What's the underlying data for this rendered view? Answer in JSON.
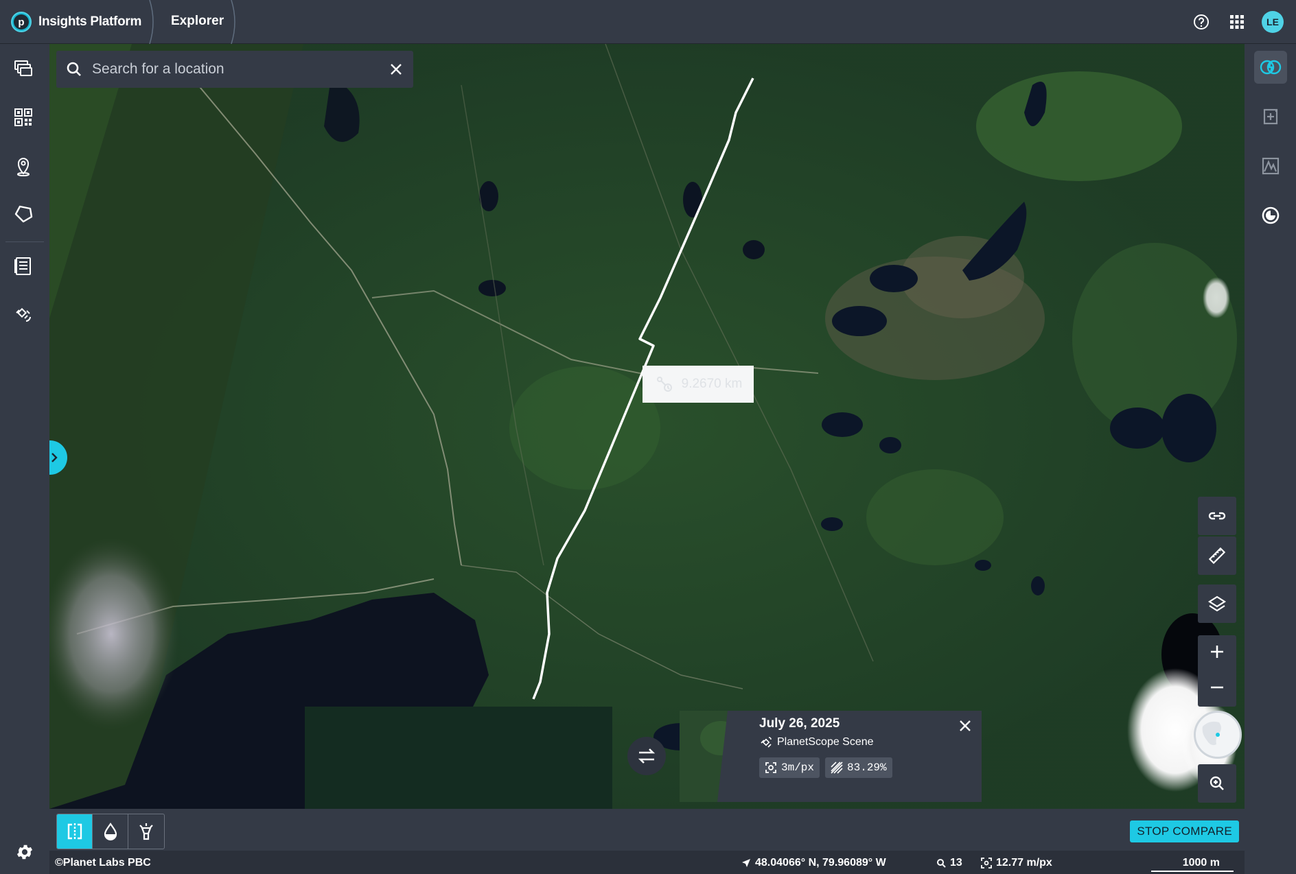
{
  "app": {
    "brand_name": "Insights Platform",
    "section": "Explorer",
    "user_initials": "LE",
    "accent_color": "#1ec9e4"
  },
  "topbar": {
    "icons": [
      "help-icon",
      "apps-grid-icon"
    ]
  },
  "left_rail": {
    "items": [
      "feeds-icon",
      "dashboard-icon",
      "places-icon",
      "areas-icon",
      "reports-icon",
      "tasking-icon"
    ],
    "settings_icon": "gear-icon"
  },
  "right_rail": {
    "items": [
      "compare-icon",
      "add-analysis-icon",
      "elevation-icon",
      "time-icon"
    ]
  },
  "search": {
    "placeholder": "Search for a location",
    "value": ""
  },
  "measurement": {
    "label": "9.2670 km"
  },
  "scene": {
    "date": "July 26, 2025",
    "type": "PlanetScope Scene",
    "resolution": "3m/px",
    "cloud_cover": "83.29%"
  },
  "map_controls": [
    "link-icon",
    "ruler-icon",
    "layers-icon",
    "zoom-in-icon",
    "zoom-out-icon",
    "globe-icon",
    "zoom-search-icon"
  ],
  "bottom_bar": {
    "modes": [
      "swipe-compare-icon",
      "opacity-icon",
      "spotlight-icon"
    ],
    "stop_compare_label": "STOP COMPARE"
  },
  "status": {
    "attribution": "©Planet Labs PBC",
    "coordinates": "48.04066° N, 79.96089° W",
    "zoom_level": "13",
    "resolution": "12.77 m/px",
    "scale": "1000 m"
  }
}
